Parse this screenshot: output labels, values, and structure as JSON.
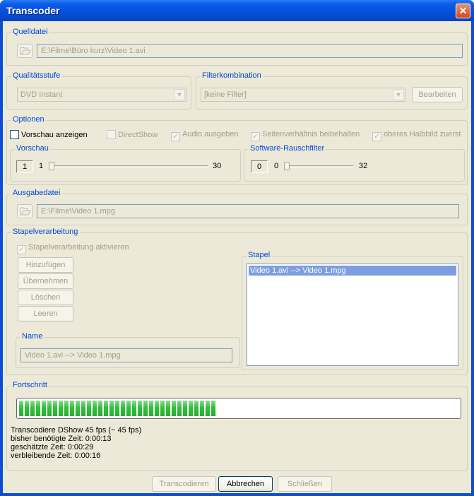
{
  "window": {
    "title": "Transcoder",
    "close_glyph": "✕"
  },
  "source": {
    "group_title": "Quelldatei",
    "path": "E:\\Filme\\Büro kurz\\Video 1.avi",
    "browse_icon": "open-folder-icon"
  },
  "quality": {
    "group_title": "Qualitätsstufe",
    "selected": "DVD Instant"
  },
  "filter": {
    "group_title": "Filterkombination",
    "selected": "[keine Filter]",
    "edit_label": "Bearbeiten"
  },
  "options": {
    "group_title": "Optionen",
    "checkboxes": [
      {
        "label": "Vorschau anzeigen",
        "checked": false,
        "enabled": true
      },
      {
        "label": "DirectShow",
        "checked": false,
        "enabled": false
      },
      {
        "label": "Audio ausgeben",
        "checked": true,
        "enabled": false
      },
      {
        "label": "Seitenverhältnis beibehalten",
        "checked": true,
        "enabled": false
      },
      {
        "label": "oberes Halbbild zuerst",
        "checked": true,
        "enabled": false
      }
    ],
    "preview": {
      "group_title": "Vorschau",
      "value": "1",
      "min": "1",
      "max": "30"
    },
    "noise": {
      "group_title": "Software-Rauschfilter",
      "value": "0",
      "min": "0",
      "max": "32"
    }
  },
  "output": {
    "group_title": "Ausgabedatei",
    "path": "E:\\Filme\\Video 1.mpg"
  },
  "batch": {
    "group_title": "Stapelverarbeitung",
    "enable_label": "Stapelverarbeitung aktivieren",
    "enable_checked": true,
    "buttons": {
      "add": "Hinzufügen",
      "apply": "Übernehmen",
      "delete": "Löschen",
      "clear": "Leeren"
    },
    "name": {
      "group_title": "Name",
      "value": "Video 1.avi --> Video 1.mpg"
    },
    "stack": {
      "group_title": "Stapel",
      "items": [
        "Video 1.avi --> Video 1.mpg"
      ]
    }
  },
  "progress": {
    "group_title": "Fortschritt",
    "fraction": 0.45,
    "lines": [
      "Transcodiere DShow 45 fps (~ 45 fps)",
      "bisher benötigte Zeit: 0:00:13",
      "geschätzte Zeit: 0:00:29",
      "verbleibende Zeit: 0:00:16"
    ]
  },
  "footer": {
    "transcode": "Transcodieren",
    "cancel": "Abbrechen",
    "close": "Schließen"
  },
  "colors": {
    "titlebar": "#0a5ce8",
    "group_title": "#0046d5",
    "progress_green": "#30c03a",
    "selection": "#7c9ee0"
  }
}
